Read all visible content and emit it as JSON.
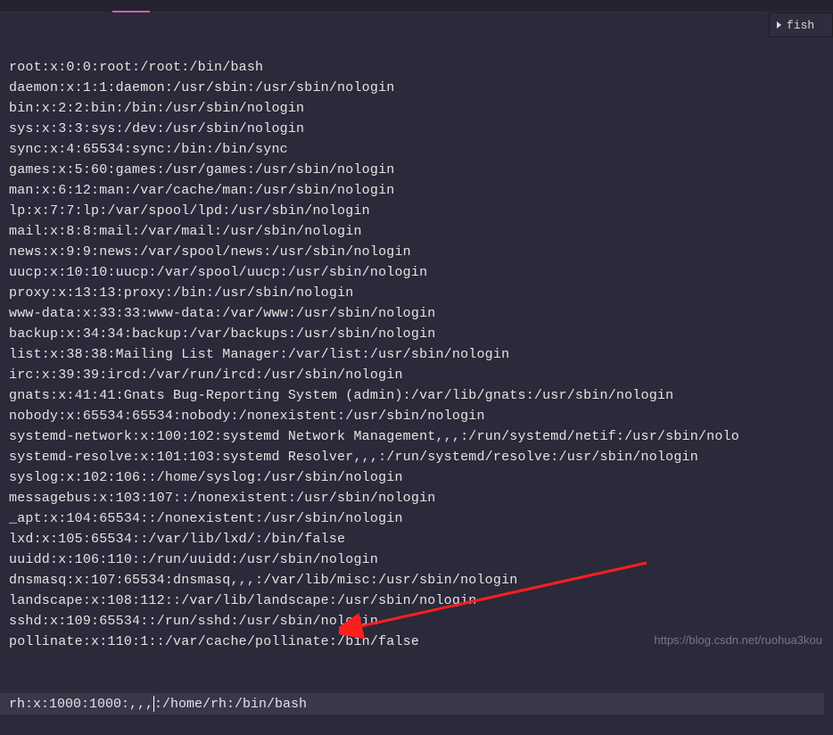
{
  "right_panel": {
    "label": "fish"
  },
  "passwd_lines": [
    "root:x:0:0:root:/root:/bin/bash",
    "daemon:x:1:1:daemon:/usr/sbin:/usr/sbin/nologin",
    "bin:x:2:2:bin:/bin:/usr/sbin/nologin",
    "sys:x:3:3:sys:/dev:/usr/sbin/nologin",
    "sync:x:4:65534:sync:/bin:/bin/sync",
    "games:x:5:60:games:/usr/games:/usr/sbin/nologin",
    "man:x:6:12:man:/var/cache/man:/usr/sbin/nologin",
    "lp:x:7:7:lp:/var/spool/lpd:/usr/sbin/nologin",
    "mail:x:8:8:mail:/var/mail:/usr/sbin/nologin",
    "news:x:9:9:news:/var/spool/news:/usr/sbin/nologin",
    "uucp:x:10:10:uucp:/var/spool/uucp:/usr/sbin/nologin",
    "proxy:x:13:13:proxy:/bin:/usr/sbin/nologin",
    "www-data:x:33:33:www-data:/var/www:/usr/sbin/nologin",
    "backup:x:34:34:backup:/var/backups:/usr/sbin/nologin",
    "list:x:38:38:Mailing List Manager:/var/list:/usr/sbin/nologin",
    "irc:x:39:39:ircd:/var/run/ircd:/usr/sbin/nologin",
    "gnats:x:41:41:Gnats Bug-Reporting System (admin):/var/lib/gnats:/usr/sbin/nologin",
    "nobody:x:65534:65534:nobody:/nonexistent:/usr/sbin/nologin",
    "systemd-network:x:100:102:systemd Network Management,,,:/run/systemd/netif:/usr/sbin/nolo",
    "systemd-resolve:x:101:103:systemd Resolver,,,:/run/systemd/resolve:/usr/sbin/nologin",
    "syslog:x:102:106::/home/syslog:/usr/sbin/nologin",
    "messagebus:x:103:107::/nonexistent:/usr/sbin/nologin",
    "_apt:x:104:65534::/nonexistent:/usr/sbin/nologin",
    "lxd:x:105:65534::/var/lib/lxd/:/bin/false",
    "uuidd:x:106:110::/run/uuidd:/usr/sbin/nologin",
    "dnsmasq:x:107:65534:dnsmasq,,,:/var/lib/misc:/usr/sbin/nologin",
    "landscape:x:108:112::/var/lib/landscape:/usr/sbin/nologin",
    "sshd:x:109:65534::/run/sshd:/usr/sbin/nologin",
    "pollinate:x:110:1::/var/cache/pollinate:/bin/false"
  ],
  "cursor_line": {
    "before": "rh:x:1000:1000:,,,",
    "after": ":/home/rh:/bin/bash"
  },
  "watermark": "https://blog.csdn.net/ruohua3kou"
}
